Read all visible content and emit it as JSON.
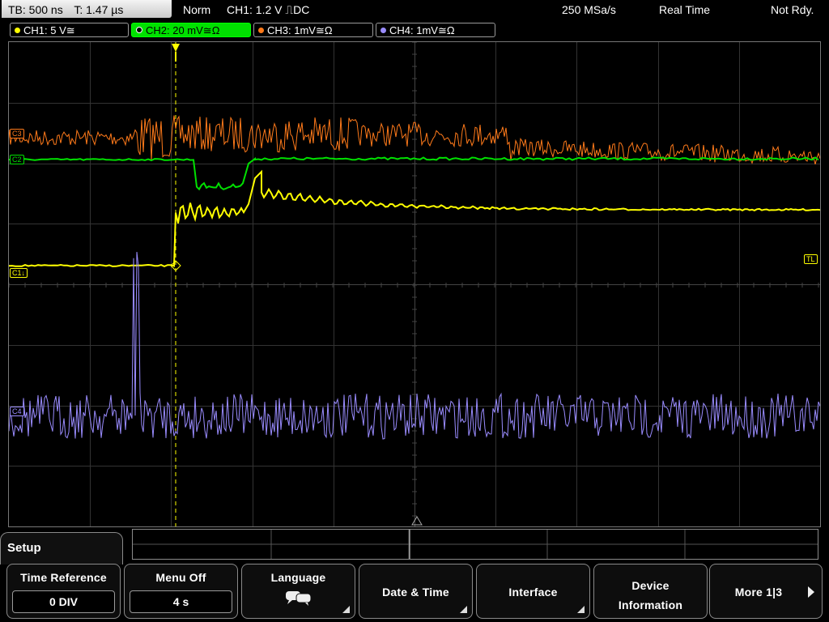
{
  "status": {
    "timebase": "TB: 500 ns",
    "trigger_time": "T: 1.47 µs",
    "mode": "Norm",
    "trigger": "CH1: 1.2 V ⎍DC",
    "sample_rate": "250 MSa/s",
    "acq_mode": "Real Time",
    "state": "Not Rdy."
  },
  "channels": [
    {
      "label": "CH1: 5 V≅",
      "color": "#ffff00"
    },
    {
      "label": "CH2: 20 mV≅Ω",
      "color": "#00e000"
    },
    {
      "label": "CH3: 1mV≅Ω",
      "color": "#ff7a1a"
    },
    {
      "label": "CH4: 1mV≅Ω",
      "color": "#9a8cff"
    }
  ],
  "markers": {
    "c3": "C3",
    "c2": "C2",
    "c1": "C1↓",
    "c4": "C4",
    "trigger_level": "TL"
  },
  "menu": {
    "title": "Setup",
    "softkeys": [
      {
        "label": "Time Reference",
        "value": "0 DIV"
      },
      {
        "label": "Menu Off",
        "value": "4 s"
      },
      {
        "label": "Language",
        "icon": "speech-bubbles-icon"
      },
      {
        "label": "Date & Time"
      },
      {
        "label": "Interface"
      },
      {
        "label": "Device Information"
      },
      {
        "label": "More 1|3"
      }
    ]
  }
}
